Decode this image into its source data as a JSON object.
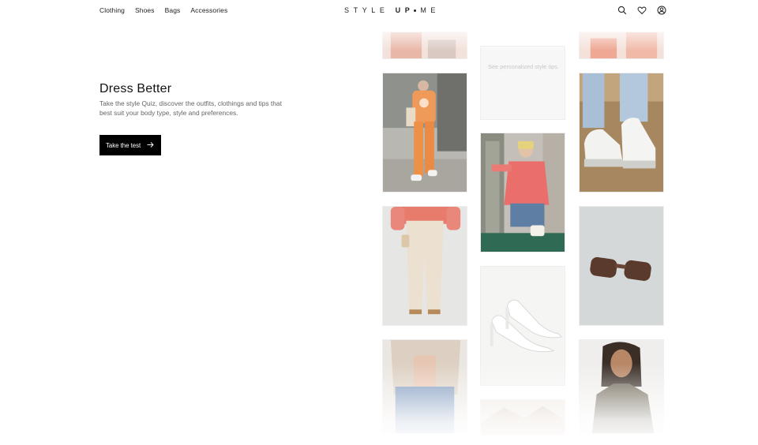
{
  "header": {
    "nav": [
      "Clothing",
      "Shoes",
      "Bags",
      "Accessories"
    ],
    "logo": {
      "part1": "STYLE",
      "part2": "UP",
      "part3": "ME"
    },
    "icons": [
      "search-icon",
      "heart-icon",
      "user-icon"
    ]
  },
  "hero": {
    "title": "Dress Better",
    "description": "Take the style Quiz, discover the outfits, clothings and tips that best suit your body type, style and preferences.",
    "cta_label": "Take the test"
  },
  "grid": {
    "tip_text": "See personalized style tips.",
    "images": [
      "top-partial-image-left",
      "orange-tracksuit-photo",
      "denim-sneakers-photo",
      "pink-shirt-skirt-photo",
      "cream-trousers-photo",
      "sunglasses-photo",
      "white-heels-photo",
      "sheer-blouse-photo",
      "model-portrait-photo",
      "top-partial-image-right",
      "bottom-partial-image-center"
    ]
  },
  "colors": {
    "accent": "#000000",
    "text": "#111111",
    "muted": "#666666",
    "tip_bg": "#f7f7f7"
  }
}
